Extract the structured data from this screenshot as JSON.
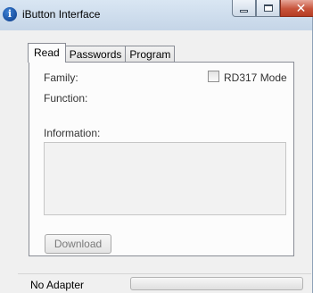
{
  "window": {
    "title": "iButton Interface",
    "app_icon_glyph": "i",
    "ghost_text_1": "",
    "ghost_text_2": ""
  },
  "caption_buttons": {
    "minimize": "minimize-icon",
    "maximize": "maximize-icon",
    "close": "close-icon",
    "close_glyph": "✕"
  },
  "tabs": [
    {
      "label": "Read",
      "active": true
    },
    {
      "label": "Passwords",
      "active": false
    },
    {
      "label": "Program",
      "active": false
    }
  ],
  "read_panel": {
    "family_label": "Family:",
    "function_label": "Function:",
    "rd317_label": "RD317 Mode",
    "rd317_checked": false,
    "information_label": "Information:",
    "information_value": "",
    "download_label": "Download"
  },
  "statusbar": {
    "status_text": "No Adapter",
    "progress": 0
  }
}
